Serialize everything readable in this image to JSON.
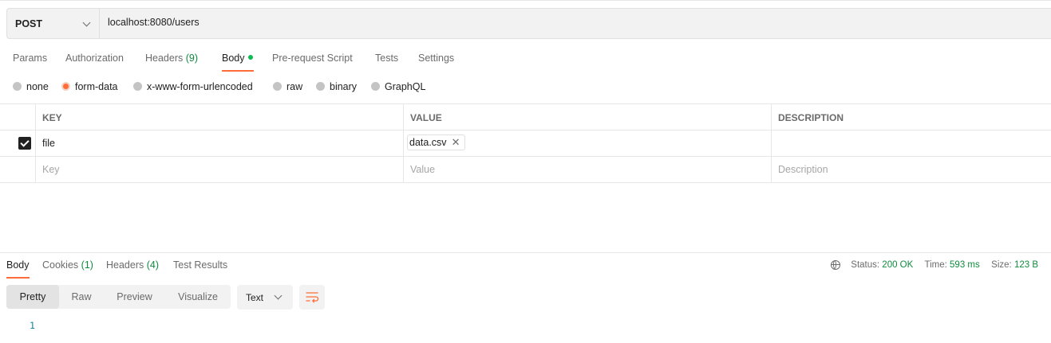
{
  "request": {
    "method": "POST",
    "url": "localhost:8080/users"
  },
  "request_tabs": [
    {
      "label": "Params",
      "count": ""
    },
    {
      "label": "Authorization",
      "count": ""
    },
    {
      "label": "Headers",
      "count": "(9)"
    },
    {
      "label": "Body",
      "count": ""
    },
    {
      "label": "Pre-request Script",
      "count": ""
    },
    {
      "label": "Tests",
      "count": ""
    },
    {
      "label": "Settings",
      "count": ""
    }
  ],
  "active_request_tab": "Body",
  "body_types": [
    {
      "label": "none",
      "selected": false
    },
    {
      "label": "form-data",
      "selected": true
    },
    {
      "label": "x-www-form-urlencoded",
      "selected": false
    },
    {
      "label": "raw",
      "selected": false
    },
    {
      "label": "binary",
      "selected": false
    },
    {
      "label": "GraphQL",
      "selected": false
    }
  ],
  "form_table": {
    "headers": {
      "key": "KEY",
      "value": "VALUE",
      "description": "DESCRIPTION"
    },
    "rows": [
      {
        "checked": true,
        "key": "file",
        "value_file": "data.csv",
        "description": ""
      }
    ],
    "placeholders": {
      "key": "Key",
      "value": "Value",
      "description": "Description"
    }
  },
  "response_tabs": [
    {
      "label": "Body",
      "count": ""
    },
    {
      "label": "Cookies",
      "count": "(1)"
    },
    {
      "label": "Headers",
      "count": "(4)"
    },
    {
      "label": "Test Results",
      "count": ""
    }
  ],
  "active_response_tab": "Body",
  "response_status": {
    "status_label": "Status:",
    "status_value": "200 OK",
    "time_label": "Time:",
    "time_value": "593 ms",
    "size_label": "Size:",
    "size_value": "123 B"
  },
  "view_modes": [
    "Pretty",
    "Raw",
    "Preview",
    "Visualize"
  ],
  "active_view_mode": "Pretty",
  "format_select": "Text",
  "response_lines": [
    "1"
  ],
  "colors": {
    "accent": "#ff6c37",
    "status_ok": "#0e8b3d",
    "body_dot": "#0cbb52",
    "line_number": "#1b7fa3"
  },
  "icons": [
    "chevron-down-icon",
    "checkbox-checked-icon",
    "close-icon",
    "globe-icon",
    "wrap-lines-icon"
  ]
}
